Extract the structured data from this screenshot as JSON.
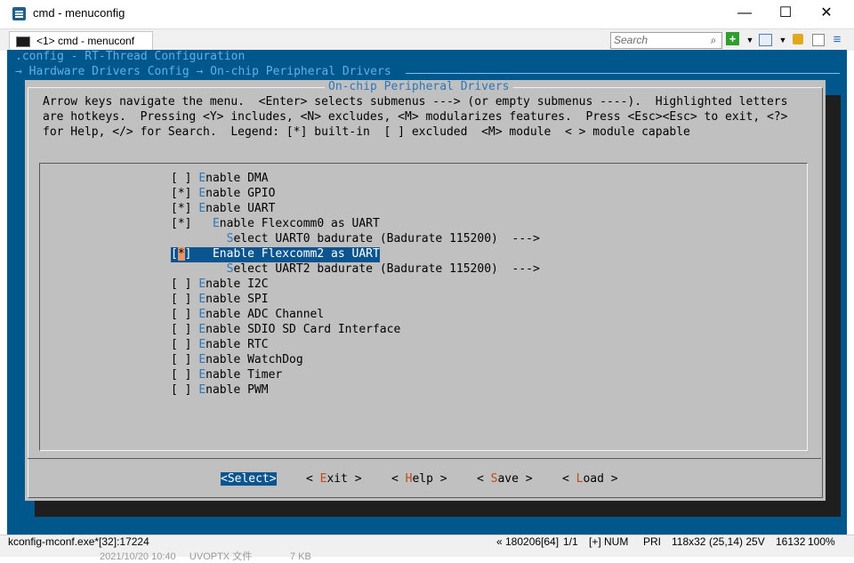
{
  "window": {
    "title": "cmd - menuconfig",
    "min_glyph": "—",
    "max_glyph": "☐",
    "close_glyph": "✕"
  },
  "tab": {
    "label": "<1> cmd - menuconf"
  },
  "toolbar": {
    "search_placeholder": "Search",
    "icons": [
      "search-icon",
      "add-icon",
      "dropdown-icon",
      "window-icon",
      "dropdown-icon",
      "lock-icon",
      "panel-icon",
      "menu-icon"
    ]
  },
  "console": {
    "breadcrumb_config": ".config - RT-Thread Configuration",
    "breadcrumb_path": "→ Hardware Drivers Config → On-chip Peripheral Drivers ",
    "dialog_title": "On-chip Peripheral Drivers",
    "help_lines": [
      "Arrow keys navigate the menu.  <Enter> selects submenus ---> (or empty submenus ----).  Highlighted letters",
      "are hotkeys.  Pressing <Y> includes, <N> excludes, <M> modularizes features.  Press <Esc><Esc> to exit, <?>",
      "for Help, </> for Search.  Legend: [*] built-in  [ ] excluded  <M> module  < > module capable"
    ],
    "items": [
      {
        "box": "[ ] ",
        "pad": "",
        "hk": "E",
        "rest": "nable DMA",
        "selected": false
      },
      {
        "box": "[*] ",
        "pad": "",
        "hk": "E",
        "rest": "nable GPIO",
        "selected": false
      },
      {
        "box": "[*] ",
        "pad": "",
        "hk": "E",
        "rest": "nable UART",
        "selected": false
      },
      {
        "box": "[*] ",
        "pad": "  ",
        "hk": "E",
        "rest": "nable Flexcomm0 as UART",
        "selected": false
      },
      {
        "box": "    ",
        "pad": "    ",
        "hk": "S",
        "rest": "elect UART0 badurate (Badurate 115200)  --->",
        "selected": false
      },
      {
        "box_pre": "[",
        "box_cur": "*",
        "box_post": "] ",
        "pad": "  ",
        "hk": "E",
        "rest": "nable Flexcomm2 as UART",
        "selected": true
      },
      {
        "box": "    ",
        "pad": "    ",
        "hk": "S",
        "rest": "elect UART2 badurate (Badurate 115200)  --->",
        "selected": false
      },
      {
        "box": "[ ] ",
        "pad": "",
        "hk": "E",
        "rest": "nable I2C",
        "selected": false
      },
      {
        "box": "[ ] ",
        "pad": "",
        "hk": "E",
        "rest": "nable SPI",
        "selected": false
      },
      {
        "box": "[ ] ",
        "pad": "",
        "hk": "E",
        "rest": "nable ADC Channel",
        "selected": false
      },
      {
        "box": "[ ] ",
        "pad": "",
        "hk": "E",
        "rest": "nable SDIO SD Card Interface",
        "selected": false
      },
      {
        "box": "[ ] ",
        "pad": "",
        "hk": "E",
        "rest": "nable RTC",
        "selected": false
      },
      {
        "box": "[ ] ",
        "pad": "",
        "hk": "E",
        "rest": "nable WatchDog",
        "selected": false
      },
      {
        "box": "[ ] ",
        "pad": "",
        "hk": "E",
        "rest": "nable Timer",
        "selected": false
      },
      {
        "box": "[ ] ",
        "pad": "",
        "hk": "E",
        "rest": "nable PWM",
        "selected": false
      }
    ],
    "buttons": {
      "select": "<Select>",
      "exit": {
        "pre": "< ",
        "hk": "E",
        "rest": "xit >"
      },
      "help": {
        "pre": "< ",
        "hk": "H",
        "rest": "elp >"
      },
      "save": {
        "pre": "< ",
        "hk": "S",
        "rest": "ave >"
      },
      "load": {
        "pre": "< ",
        "hk": "L",
        "rest": "oad >"
      }
    }
  },
  "status": {
    "process": "kconfig-mconf.exe*[32]:17224",
    "session": "« 180206[64]",
    "tabs": "1/1",
    "flags": "[+] NUM",
    "pri": "PRI",
    "size": "118x32",
    "cursor": "(25,14) 25V",
    "memory": "16132",
    "zoom": "100%"
  },
  "background_text": "2021/10/20 10:40     UVOPTX 文件              7 KB",
  "colors": {
    "console_bg": "#00578b",
    "dialog_bg": "#c0c0c0",
    "hotkey": "#2f77b8",
    "button_hotkey": "#c14a1c",
    "selection": "#0a5590",
    "cursor": "#e8956a"
  }
}
